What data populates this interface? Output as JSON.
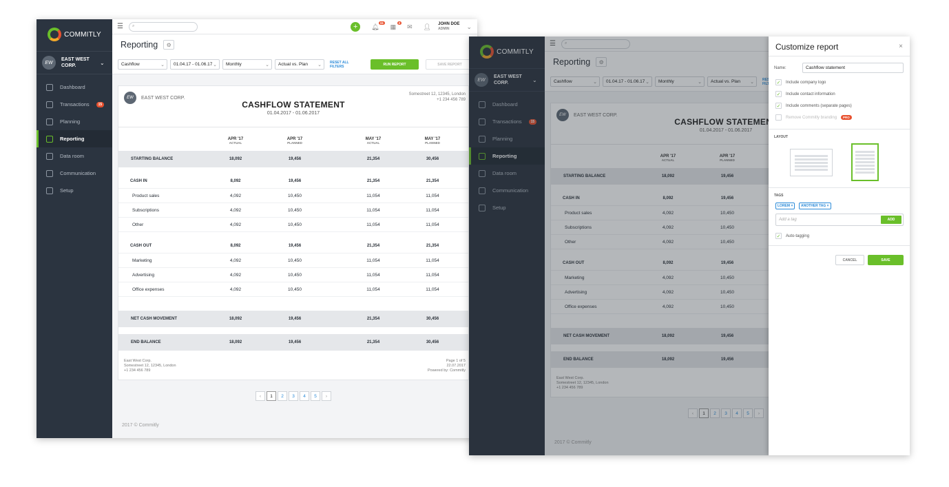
{
  "app": {
    "brand": "COMMITLY",
    "org": "EAST WEST CORP.",
    "org_short": "EW"
  },
  "nav": [
    {
      "label": "Dashboard",
      "icon": "clock-icon"
    },
    {
      "label": "Transactions",
      "icon": "transfer-icon",
      "badge": "15"
    },
    {
      "label": "Planning",
      "icon": "planning-icon"
    },
    {
      "label": "Reporting",
      "icon": "report-icon",
      "active": true
    },
    {
      "label": "Data room",
      "icon": "folder-icon"
    },
    {
      "label": "Communication",
      "icon": "chat-icon"
    },
    {
      "label": "Setup",
      "icon": "gear-icon"
    }
  ],
  "topbar": {
    "notif_badge": "15",
    "cal_badge": "2",
    "user_name": "JOHN DOE",
    "user_role": "ADMIN"
  },
  "page": {
    "title": "Reporting"
  },
  "filters": {
    "report": "Cashflow",
    "dates": "01.04.17 - 01.06.17",
    "period": "Monthly",
    "compare": "Actual vs. Plan",
    "reset": "RESET ALL FILTERS",
    "run": "RUN REPORT",
    "save": "SAVE REPORT"
  },
  "report": {
    "company": "EAST WEST CORP.",
    "addr1": "Somestreet 12, 12345, London",
    "addr2": "+1 234 456 789",
    "title": "CASHFLOW STATEMENT",
    "period": "01.04.2017 - 01.06.2017",
    "columns": [
      {
        "m": "APR '17",
        "t": "ACTUAL"
      },
      {
        "m": "APR '17",
        "t": "PLANNED"
      },
      {
        "m": "MAY '17",
        "t": "ACTUAL"
      },
      {
        "m": "MAY '17",
        "t": "PLANNED"
      }
    ],
    "rows": [
      {
        "kind": "tot",
        "label": "STARTING BALANCE",
        "v": [
          "18,092",
          "19,456",
          "21,354",
          "30,456"
        ]
      },
      {
        "kind": "gap"
      },
      {
        "kind": "sec",
        "label": "CASH IN",
        "v": [
          "8,092",
          "19,456",
          "21,354",
          "21,354"
        ]
      },
      {
        "kind": "row",
        "label": "Product sales",
        "v": [
          "4,092",
          "10,450",
          "11,054",
          "11,054"
        ]
      },
      {
        "kind": "row",
        "label": "Subscriptions",
        "v": [
          "4,092",
          "10,450",
          "11,054",
          "11,054"
        ]
      },
      {
        "kind": "row",
        "label": "Other",
        "v": [
          "4,092",
          "10,450",
          "11,054",
          "11,054"
        ]
      },
      {
        "kind": "gap"
      },
      {
        "kind": "sec",
        "label": "CASH OUT",
        "v": [
          "8,092",
          "19,456",
          "21,354",
          "21,354"
        ]
      },
      {
        "kind": "row",
        "label": "Marketing",
        "v": [
          "4,092",
          "10,450",
          "11,054",
          "11,054"
        ]
      },
      {
        "kind": "row",
        "label": "Advertising",
        "v": [
          "4,092",
          "10,450",
          "11,054",
          "11,054"
        ]
      },
      {
        "kind": "row",
        "label": "Office expenses",
        "v": [
          "4,092",
          "10,450",
          "11,054",
          "11,054"
        ]
      },
      {
        "kind": "gap"
      },
      {
        "kind": "gap"
      },
      {
        "kind": "tot",
        "label": "NET CASH MOVEMENT",
        "v": [
          "18,092",
          "19,456",
          "21,354",
          "30,456"
        ]
      },
      {
        "kind": "gap"
      },
      {
        "kind": "tot",
        "label": "END BALANCE",
        "v": [
          "18,092",
          "19,456",
          "21,354",
          "30,456"
        ]
      }
    ],
    "footer_l": [
      "East West Corp.",
      "Somestreet 12, 12345, London",
      "+1 234 456 789"
    ],
    "footer_r": [
      "Page 1 of 5",
      "22.07.2017",
      "Powered by: Commitly"
    ]
  },
  "pages": [
    "1",
    "2",
    "3",
    "4",
    "5"
  ],
  "copyright": "2017 © Commitly",
  "customize": {
    "title": "Customize report",
    "name_label": "Name:",
    "name_value": "Cashflow statement",
    "options": [
      {
        "label": "Include company logo",
        "checked": true
      },
      {
        "label": "Include contact information",
        "checked": true
      },
      {
        "label": "Include comments (separate pages)",
        "checked": true
      },
      {
        "label": "Remove Commitly branding",
        "checked": false,
        "pro": "PRO"
      }
    ],
    "layout_label": "LAYOUT",
    "tags_label": "TAGS",
    "tags": [
      "LOREM",
      "ANOTHER TAG"
    ],
    "tag_placeholder": "Add a tag",
    "add": "ADD",
    "auto": "Auto-tagging",
    "cancel": "CANCEL",
    "save": "SAVE"
  }
}
